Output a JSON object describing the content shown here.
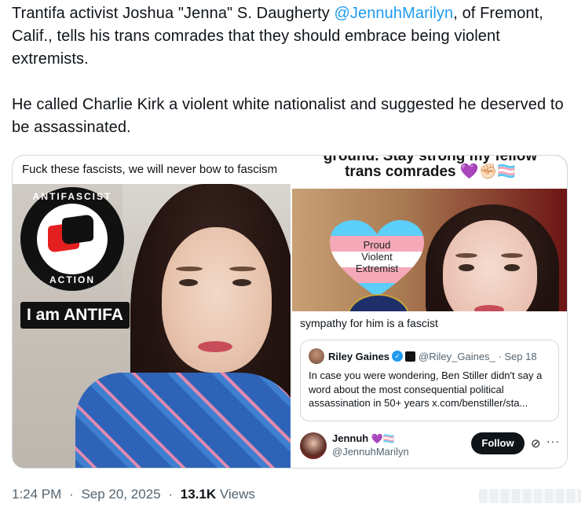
{
  "tweet": {
    "text_before_mention": "Trantifa activist Joshua \"Jenna\" S. Daugherty ",
    "mention": "@JennuhMarilyn",
    "text_after_mention": ", of Fremont, Calif., tells his trans comrades that they should embrace being violent extremists.",
    "paragraph2": "He called Charlie Kirk a violent white nationalist and suggested he deserved to be assassinated."
  },
  "media": {
    "left": {
      "caption": "Fuck these fascists, we will never bow to fascism",
      "logo_top": "ANTIFASCIST",
      "logo_bottom": "ACTION",
      "badge": "I am ANTIFA"
    },
    "right_top": {
      "banner_line1": "ground. Stay strong my fellow",
      "banner_line2": "trans comrades 💜✊🏻🏳️‍⚧️",
      "heart_text": "Proud\nViolent\nExtremist"
    },
    "right_bottom": {
      "cut_text": "sympathy for him is a fascist",
      "quote": {
        "name": "Riley Gaines",
        "handle_date": "@Riley_Gaines_ · Sep 18",
        "body": "In case you were wondering, Ben Stiller didn't say a word about the most consequential political assassination in 50+ years x.com/benstiller/sta..."
      },
      "user": {
        "name": "Jennuh",
        "name_emoji": "💜🏳️‍⚧️",
        "handle": "@JennuhMarilyn",
        "follow_label": "Follow",
        "grok_glyph": "⊘",
        "more_glyph": "···"
      }
    }
  },
  "meta": {
    "time": "1:24 PM",
    "separator": "·",
    "date": "Sep 20, 2025",
    "views_count": "13.1K",
    "views_label": "Views"
  },
  "colors": {
    "accent": "#1d9bf0",
    "text": "#0f1419",
    "muted": "#536471"
  }
}
